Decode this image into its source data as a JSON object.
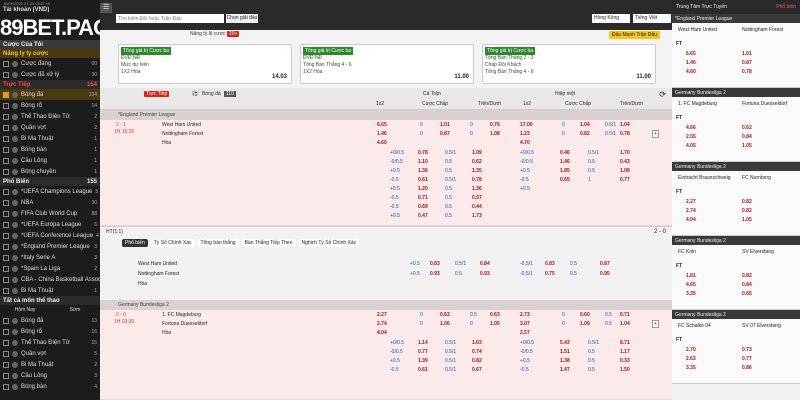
{
  "brand": "89BET.PAGE",
  "datetime": "18/05/2021 21:23 GMT +8",
  "left": {
    "account": "Tài khoản (VND)",
    "settings_header": "Cược Của Tôi",
    "sec1": {
      "label": "Nâng ly ly cược",
      "items": [
        {
          "label": "Cược đang",
          "cnt": "00"
        },
        {
          "label": "Cược đã xử lý",
          "cnt": "30"
        }
      ]
    },
    "live": {
      "label": "Trực Tiếp",
      "cnt": "154",
      "items": [
        {
          "label": "Bóng đá",
          "cnt": "134",
          "on": true
        },
        {
          "label": "Bóng rổ",
          "cnt": "14"
        },
        {
          "label": "Thể Thao Điện Tử",
          "cnt": "2"
        },
        {
          "label": "Quần vợt",
          "cnt": "2"
        },
        {
          "label": "Bi Ma Thuật",
          "cnt": "1"
        },
        {
          "label": "Bóng bàn",
          "cnt": "1"
        },
        {
          "label": "Cầu Lông",
          "cnt": "1"
        },
        {
          "label": "Bóng chuyền",
          "cnt": "1"
        }
      ]
    },
    "popular": {
      "label": "Phổ Biến",
      "cnt": "155",
      "items": [
        {
          "label": "*UEFA Champions League",
          "cnt": "5"
        },
        {
          "label": "NBA",
          "cnt": "30"
        },
        {
          "label": "FIFA Club World Cup",
          "cnt": "88"
        },
        {
          "label": "*UEFA Europa League",
          "cnt": "6"
        },
        {
          "label": "*UEFA Conference League",
          "cnt": "4"
        },
        {
          "label": "*England Premier League",
          "cnt": "3"
        },
        {
          "label": "*Italy Serie A",
          "cnt": "3"
        },
        {
          "label": "*Spain La Liga",
          "cnt": "2"
        },
        {
          "label": "CBA - China Basketball Association",
          "cnt": "2"
        },
        {
          "label": "Bi Ma Thuật",
          "cnt": "1"
        }
      ]
    },
    "all": {
      "label": "Tất cả môn thể thao",
      "tab1": "Hôm Nay",
      "tab2": "Sớm",
      "items": [
        {
          "label": "Bóng đá",
          "cnt": "13"
        },
        {
          "label": "Bóng rổ",
          "cnt": "16"
        },
        {
          "label": "Thể Thao Điện Tử",
          "cnt": "15"
        },
        {
          "label": "Quần vợt",
          "cnt": "5"
        },
        {
          "label": "Bi Ma Thuật",
          "cnt": "2"
        },
        {
          "label": "Cầu Lông",
          "cnt": "3"
        },
        {
          "label": "Bóng bàn",
          "cnt": "4"
        }
      ]
    }
  },
  "topbar": {
    "search_placeholder": "Tìm kiếm Đội hoặc Trận Đấu",
    "search_btn": "Chọn giải đấu",
    "odds_select": "Hồng Kông",
    "lang_select": "Tiếng Việt"
  },
  "promo": {
    "title": "Nâng tỷ lệ cược",
    "badge": "20+",
    "right_link": "Đấu Mạnh Trận Đấu",
    "cards": [
      {
        "tag": "Tổng giá trị Cược ba",
        "l1": "ĐVĐ NĐ",
        "l2": "Mức dự kiến",
        "l3": "1X2 Hòa",
        "odd": "14.03"
      },
      {
        "tag": "Tổng giá trị Cược ba",
        "l1": "ĐVĐ NĐ",
        "l2": "Tổng Bàn Thắng 4 - 6",
        "l3": "1X2 Hòa",
        "odd": "11.00"
      },
      {
        "tag": "Tổng giá trị Cược ba",
        "l1": "Tổng Bàn Thắng 2 - 3",
        "l2": "Chấp Đội Khách",
        "l3": "Tổng Bàn Thắng 4 - 6",
        "odd": "11.00"
      }
    ]
  },
  "table": {
    "tab_live": "Trực Tiếp",
    "tab_sport": "Bóng đá",
    "tab_count": "110",
    "full": "Cả Trận",
    "half": "Hiệp một",
    "cols": [
      "1x2",
      "Cược Chấp",
      "Trên/Dưới",
      "1x2",
      "Cược Chấp",
      "Trên/Dưới"
    ],
    "league1": "*England Premier League",
    "m1": {
      "score": "2 - 1",
      "time": "1H 15:26",
      "home": "West Ham United",
      "away": "Nottingham Forest",
      "draw": "Hòa",
      "r1": [
        "6.65",
        "0",
        "1.01",
        "0",
        "0.76",
        "17.00",
        "0",
        "1.04",
        "0.5/1",
        "1.04"
      ],
      "r2": [
        "1.46",
        "0",
        "0.87",
        "0",
        "1.08",
        "1.23",
        "0",
        "0.82",
        "0.5/1",
        "0.78"
      ],
      "r3": [
        "4.60",
        "",
        "",
        "",
        "",
        "4.70",
        "",
        "",
        "",
        ""
      ],
      "extra": [
        [
          "+0/0.5",
          "0.78",
          "0.5/1",
          "1.09",
          "+0/0.5",
          "0.46",
          "0.5/1",
          "1.70"
        ],
        [
          "-0/0.5",
          "1.10",
          "0.5",
          "0.62",
          "-0/0.5",
          "1.46",
          "0.5",
          "0.43"
        ],
        [
          "+0.5",
          "1.36",
          "0.5",
          "1.35",
          "+0.5",
          "1.85",
          "0.5",
          "1.08"
        ],
        [
          "-0.5",
          "0.61",
          "0.5/1",
          "0.78",
          "-0.5",
          "0.65",
          "1",
          "0.77"
        ],
        [
          "+0.5",
          "1.20",
          "0.5",
          "1.36",
          "+0.5",
          "",
          "",
          ""
        ],
        [
          "-0.5",
          "0.71",
          "0.5",
          "0.57",
          "",
          "",
          "",
          ""
        ],
        [
          "-0.5",
          "0.69",
          "0.5",
          "0.44",
          "",
          "",
          "",
          ""
        ],
        [
          "+0.5",
          "0.47",
          "0.5",
          "1.73",
          "",
          "",
          "",
          ""
        ]
      ]
    },
    "ht": {
      "label": "HT(1:1)",
      "score": "2 - 0",
      "filters": [
        "Phổ biến",
        "Tỷ Số Chính Xác",
        "Tổng bàn thắng",
        "Bàn Thắng Tiếp Theo",
        "Nghịch Tỷ Số Chính Xác"
      ],
      "home": "West Ham United",
      "away": "Nottingham Forest",
      "draw": "Hòa",
      "h1": [
        "+0.5",
        "0.83",
        "0.5/1",
        "0.84",
        "-0.5/1",
        "0.83",
        "0.5",
        "0.87"
      ],
      "h2": [
        "+0.5",
        "0.93",
        "0.5",
        "0.93",
        "-0.5/1",
        "0.75",
        "0.5",
        "0.95"
      ]
    },
    "league2": "Germany Bundesliga 2",
    "m2": {
      "score": "0 - 0",
      "time": "1H 03:30",
      "home": "1. FC Magdeburg",
      "away": "Fortuna Duesseldorf",
      "draw": "Hòa",
      "r1": [
        "2.27",
        "0",
        "0.63",
        "0.5",
        "0.63",
        "2.73",
        "0",
        "0.60",
        "0.5",
        "0.71"
      ],
      "r2": [
        "2.74",
        "0",
        "1.06",
        "0",
        "1.05",
        "3.07",
        "0",
        "1.09",
        "0.5",
        "1.04"
      ],
      "r3": [
        "4.04",
        "",
        "",
        "",
        "",
        "2.57",
        "",
        "",
        "",
        ""
      ],
      "extra": [
        [
          "+0/0.5",
          "1.14",
          "0.5/1",
          "1.03",
          "+0/0.5",
          "5.43",
          "0.5/1",
          "8.71"
        ],
        [
          "-0/0.5",
          "0.77",
          "0.5/1",
          "0.74",
          "-0/0.5",
          "1.51",
          "0.5",
          "1.17"
        ],
        [
          "+0.5",
          "1.39",
          "0.5/1",
          "0.82",
          "+0.5",
          "1.38",
          "0.5",
          "0.33"
        ],
        [
          "-0.5",
          "0.61",
          "0.5/1",
          "0.67",
          "-0.5",
          "1.47",
          "0.5",
          "1.50"
        ]
      ]
    }
  },
  "right": {
    "title": "Trung Tâm Trực Tuyến",
    "tab2": "Phổ biến",
    "boxes": [
      {
        "league": "*England Premier League",
        "home": "West Ham United",
        "away": "Nottingham Forest",
        "time": "FT",
        "odds": [
          "6.65",
          "1.01",
          "1.46",
          "0.87",
          "4.60",
          "0.78"
        ]
      },
      {
        "league": "Germany Bundesliga 2",
        "home": "1. FC Magdeburg",
        "away": "Fortuna Duesseldorf",
        "time": "FT",
        "odds": [
          "4.66",
          "0.62",
          "2.55",
          "0.84",
          "4.05",
          "1.05"
        ]
      },
      {
        "league": "Germany Bundesliga 2",
        "home": "Eintracht Braunschweig",
        "away": "FC Nurnberg",
        "time": "FT",
        "odds": [
          "2.27",
          "0.82",
          "2.74",
          "0.82",
          "4.04",
          "1.05"
        ]
      },
      {
        "league": "Germany Bundesliga 2",
        "home": "FC Koln",
        "away": "SV Elversberg",
        "time": "FT",
        "odds": [
          "1.81",
          "0.82",
          "4.65",
          "0.84",
          "3.35",
          "0.65"
        ]
      },
      {
        "league": "Germany Bundesliga 2",
        "home": "FC Schalke 04",
        "away": "SV 07 Elversberg",
        "time": "FT",
        "odds": [
          "2.70",
          "0.73",
          "2.63",
          "0.77",
          "3.35",
          "0.86"
        ]
      }
    ]
  }
}
